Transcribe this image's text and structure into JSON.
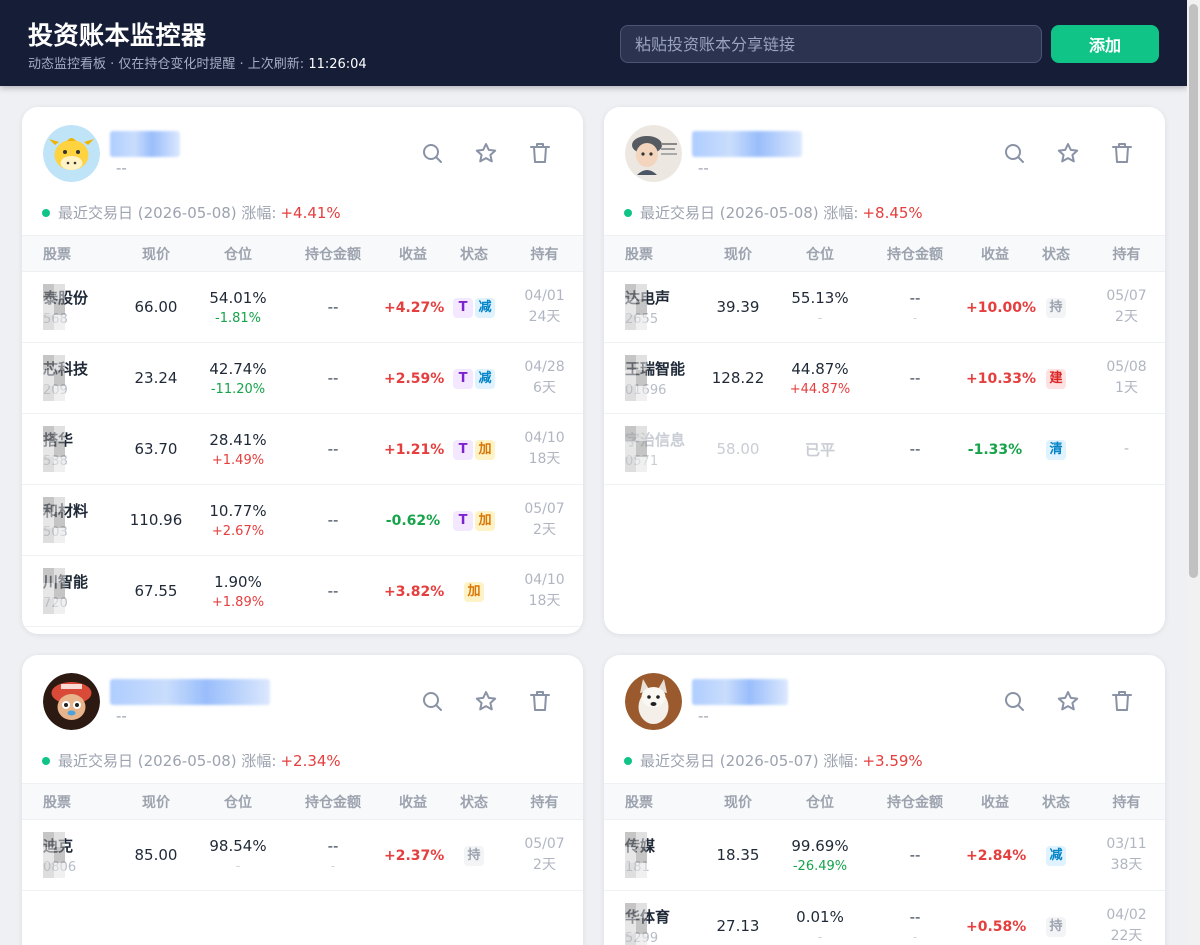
{
  "header": {
    "title": "投资账本监控器",
    "subtitle_prefix": "动态监控看板 · 仅在持仓变化时提醒 · 上次刷新: ",
    "refresh_time": "11:26:04",
    "input_placeholder": "粘贴投资账本分享链接",
    "add_label": "添加"
  },
  "columns": [
    "股票",
    "现价",
    "仓位",
    "持仓金额",
    "收益",
    "状态",
    "持有"
  ],
  "colors": {
    "up": "#e53e3e",
    "down": "#16a34a",
    "accent": "#10c487",
    "header_bg": "#161d36"
  },
  "cards": [
    {
      "sub": "--",
      "trade_label": "最近交易日 (2026-05-08) 涨幅:",
      "trade_change": "+4.41%",
      "avatar_icon": "cartoon-cow-avatar",
      "rows": [
        {
          "name": "泰股份",
          "code": "568",
          "price": "66.00",
          "pos": "54.01%",
          "pos_delta": "-1.81%",
          "amt": "--",
          "pnl": "+4.27%",
          "tags": [
            "T",
            "减"
          ],
          "date": "04/01",
          "days": "24天"
        },
        {
          "name": "芯科技",
          "code": "209",
          "price": "23.24",
          "pos": "42.74%",
          "pos_delta": "-11.20%",
          "amt": "--",
          "pnl": "+2.59%",
          "tags": [
            "T",
            "减"
          ],
          "date": "04/28",
          "days": "6天"
        },
        {
          "name": "搭华",
          "code": "538",
          "price": "63.70",
          "pos": "28.41%",
          "pos_delta": "+1.49%",
          "amt": "--",
          "pnl": "+1.21%",
          "tags": [
            "T",
            "加"
          ],
          "date": "04/10",
          "days": "18天"
        },
        {
          "name": "和材料",
          "code": "503",
          "price": "110.96",
          "pos": "10.77%",
          "pos_delta": "+2.67%",
          "amt": "--",
          "pnl": "-0.62%",
          "tags": [
            "T",
            "加"
          ],
          "date": "05/07",
          "days": "2天"
        },
        {
          "name": "川智能",
          "code": "720",
          "price": "67.55",
          "pos": "1.90%",
          "pos_delta": "+1.89%",
          "amt": "--",
          "pnl": "+3.82%",
          "tags": [
            "加"
          ],
          "date": "04/10",
          "days": "18天"
        }
      ]
    },
    {
      "sub": "--",
      "trade_label": "最近交易日 (2026-05-08) 涨幅:",
      "trade_change": "+8.45%",
      "avatar_icon": "cartoon-boy-avatar",
      "rows": [
        {
          "name": "达电声",
          "code": "2655",
          "price": "39.39",
          "pos": "55.13%",
          "pos_delta": "-",
          "amt": "--",
          "amt_sub": "-",
          "pnl": "+10.00%",
          "tags": [
            "持"
          ],
          "date": "05/07",
          "days": "2天"
        },
        {
          "name": "王瑞智能",
          "code": "01696",
          "price": "128.22",
          "pos": "44.87%",
          "pos_delta": "+44.87%",
          "amt": "--",
          "pnl": "+10.33%",
          "tags": [
            "建"
          ],
          "date": "05/08",
          "days": "1天"
        },
        {
          "name": "字治信息",
          "code": "0571",
          "price": "58.00",
          "pos": "已平",
          "pos_delta": "",
          "amt": "--",
          "pnl": "-1.33%",
          "tags": [
            "清"
          ],
          "date": "-",
          "days": "",
          "faded": true
        }
      ]
    },
    {
      "sub": "--",
      "trade_label": "最近交易日 (2026-05-08) 涨幅:",
      "trade_change": "+2.34%",
      "avatar_icon": "cartoon-character-avatar",
      "rows": [
        {
          "name": "迪克",
          "code": "0806",
          "price": "85.00",
          "pos": "98.54%",
          "pos_delta": "-",
          "amt": "--",
          "amt_sub": "-",
          "pnl": "+2.37%",
          "tags": [
            "持"
          ],
          "date": "05/07",
          "days": "2天"
        }
      ]
    },
    {
      "sub": "--",
      "trade_label": "最近交易日 (2026-05-07) 涨幅:",
      "trade_change": "+3.59%",
      "avatar_icon": "dog-photo-avatar",
      "rows": [
        {
          "name": "传媒",
          "code": "181",
          "price": "18.35",
          "pos": "99.69%",
          "pos_delta": "-26.49%",
          "amt": "--",
          "pnl": "+2.84%",
          "tags": [
            "减"
          ],
          "date": "03/11",
          "days": "38天"
        },
        {
          "name": "华体育",
          "code": "5299",
          "price": "27.13",
          "pos": "0.01%",
          "pos_delta": "-",
          "amt": "--",
          "amt_sub": "-",
          "pnl": "+0.58%",
          "tags": [
            "持"
          ],
          "date": "04/02",
          "days": "22天"
        }
      ]
    }
  ]
}
